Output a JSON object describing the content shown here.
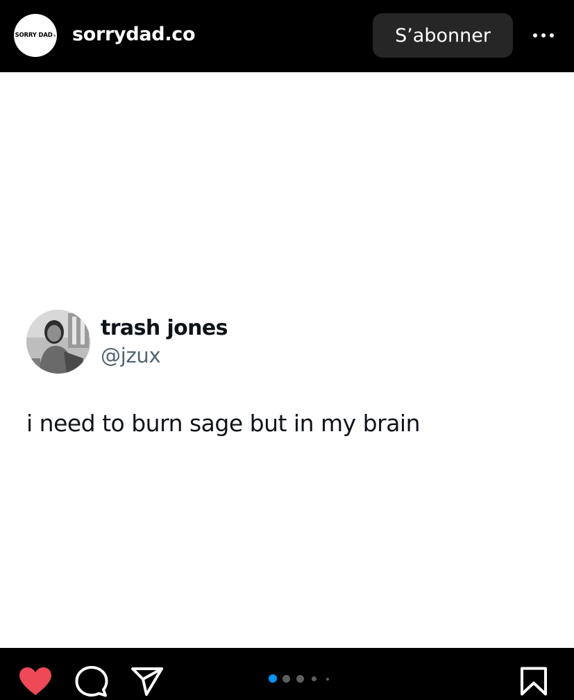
{
  "header": {
    "logo_text": "SORRY DAD",
    "username": "sorrydad.co",
    "follow_label": "S’abonner",
    "more_icon": "more-horizontal-icon"
  },
  "tweet": {
    "display_name": "trash jones",
    "handle": "@jzux",
    "text": "i need to burn sage but in my brain"
  },
  "actions": {
    "like_icon": "heart-filled-icon",
    "like_color": "#ed4956",
    "comment_icon": "comment-icon",
    "share_icon": "send-icon",
    "save_icon": "bookmark-icon"
  },
  "carousel": {
    "total_dots": 5,
    "active_index": 0,
    "active_color": "#0095f6"
  }
}
